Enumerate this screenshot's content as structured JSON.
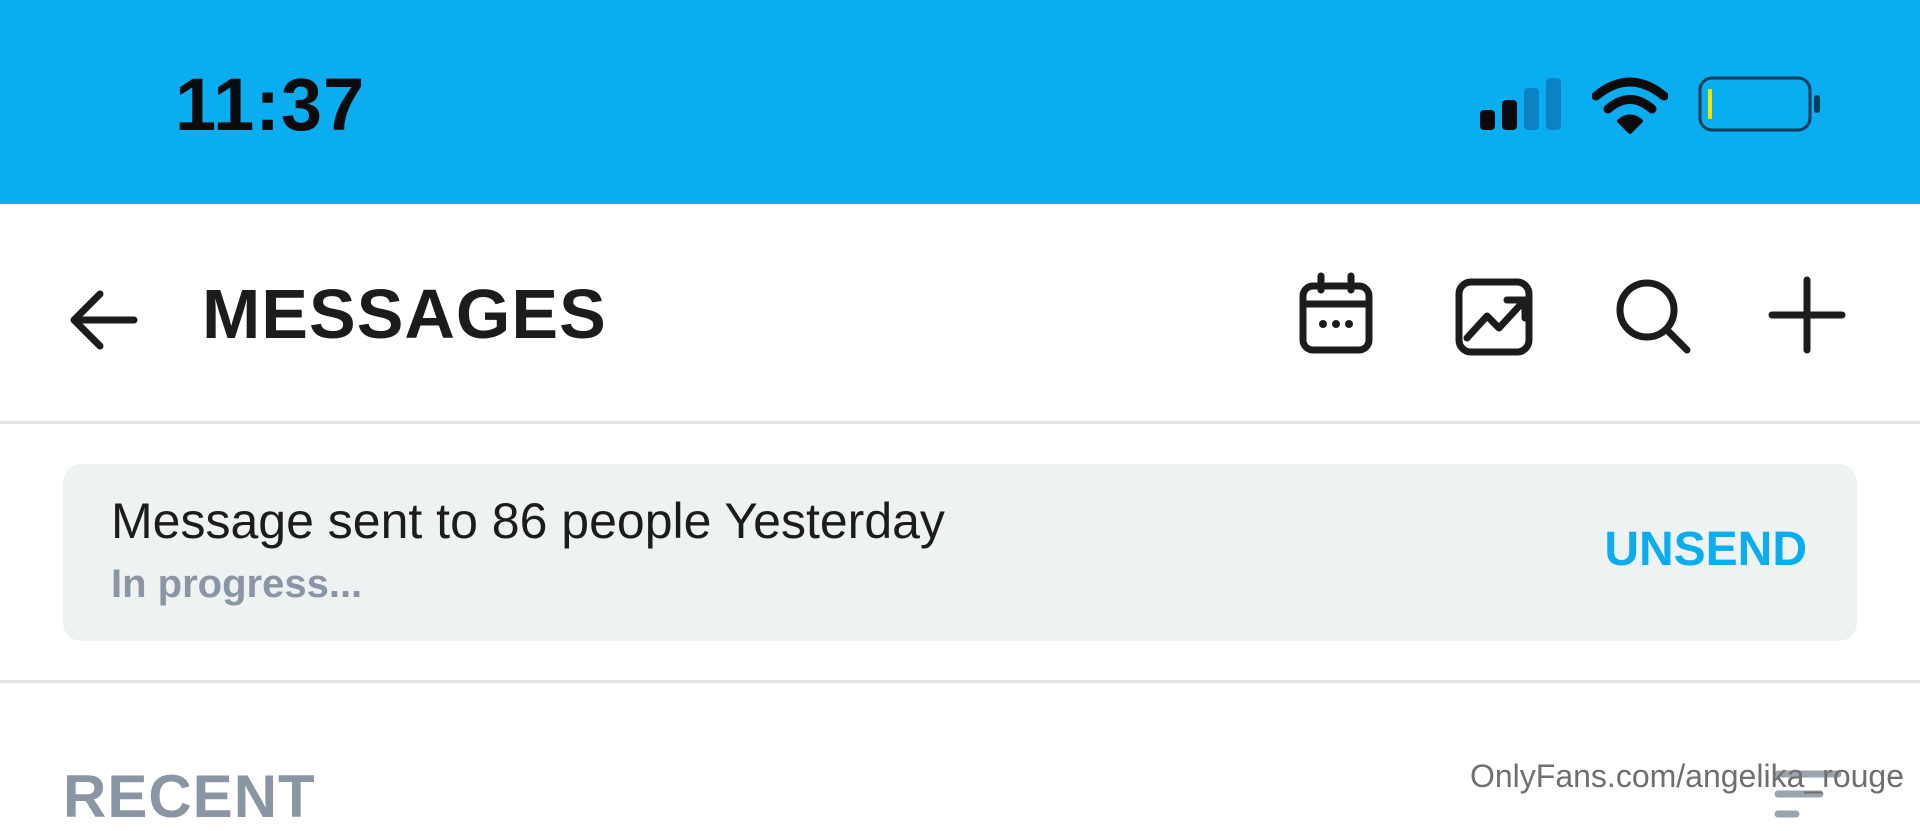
{
  "status_bar": {
    "time": "11:37",
    "icons": [
      "cellular-signal-icon",
      "wifi-icon",
      "battery-low-icon"
    ],
    "background_color": "#0aaef0"
  },
  "header": {
    "title": "MESSAGES",
    "icons": [
      "back-arrow-icon",
      "calendar-icon",
      "stats-chart-icon",
      "search-icon",
      "plus-icon"
    ]
  },
  "notice": {
    "message": "Message sent to 86 people Yesterday",
    "status": "In progress...",
    "action_label": "UNSEND",
    "accent_color": "#0aaef0"
  },
  "recent": {
    "label": "RECENT",
    "sort_icon": "sort-lines-icon"
  },
  "watermark": "OnlyFans.com/angelika_rouge"
}
